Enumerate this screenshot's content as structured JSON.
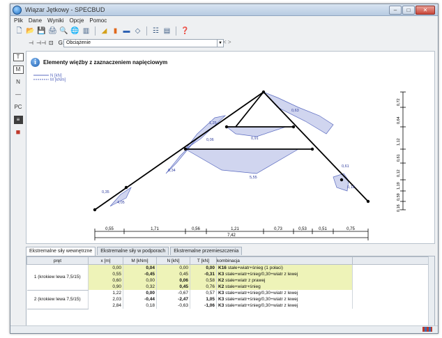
{
  "window": {
    "title": "Wiązar Jętkowy - SPECBUD",
    "controls": {
      "minimize": "–",
      "maximize": "□",
      "close": "✕"
    }
  },
  "menu": [
    "Plik",
    "Dane",
    "Wyniki",
    "Opcje",
    "Pomoc"
  ],
  "toolbar": {
    "icons": [
      "new-icon",
      "open-icon",
      "save-icon",
      "print-icon",
      "preview-icon",
      "globe-icon",
      "chart-icon",
      "triangle-icon",
      "bars-icon",
      "beam-icon",
      "diamond-icon",
      "grid-icon",
      "table-icon",
      "help-icon"
    ],
    "glyphs": [
      "🗋",
      "📂",
      "💾",
      "🖨",
      "🔍",
      "🌐",
      "▥",
      "◢",
      "▮",
      "▬",
      "◇",
      "☷",
      "▤",
      "❓"
    ]
  },
  "secondary_toolbar": {
    "buttons": [
      "⊣",
      "⊣⊣",
      "⊡"
    ],
    "load_case_label": "G:",
    "load_case_value": "Obciążenie",
    "nav": "< >"
  },
  "left_tools": [
    "T",
    "M",
    "N",
    "—",
    "PC",
    "≡",
    "■"
  ],
  "diagram": {
    "info_glyph": "i",
    "title": "Elementy więźby z zaznaczeniem napięciowym",
    "legend": [
      "N [kN]",
      "M [kNm]"
    ],
    "dimension_segments": [
      "0,55",
      "1,71",
      "0,56",
      "1,21",
      "0,73",
      "0,53",
      "0,51",
      "0,75"
    ],
    "dimension_total": "7,42",
    "vertical_dims": [
      "0,16",
      "0,59",
      "1,19",
      "0,12",
      "0,61",
      "1,12",
      "0,64",
      "0,72"
    ],
    "value_labels": [
      "0,35",
      "4,05",
      "0,34",
      "0,06",
      "0,91",
      "5,55",
      "0,63",
      "0,61",
      "0,12",
      "1,25"
    ],
    "colors": {
      "diagram_line": "#5b6bc0",
      "member": "#000000",
      "fill": "#8a96d6"
    }
  },
  "tabs": [
    "Ekstremalne siły wewnętrzne",
    "Ekstremalne siły w podporach",
    "Ekstremalne przemieszczenia"
  ],
  "table": {
    "headers": [
      "pręt",
      "x [m]",
      "M [kNm]",
      "N [kN]",
      "T [kN]",
      "kombinacja"
    ],
    "groups": [
      {
        "member": "1 (krokiew lewa 7,5/15)",
        "highlight": true,
        "rows": [
          {
            "x": "0,00",
            "M": "0,04",
            "N": "0,00",
            "T": "0,00",
            "code": "K16",
            "note": "stałe+wiatr+śnieg (1 połaci)"
          },
          {
            "x": "0,55",
            "M": "-0,45",
            "N": "0,45",
            "T": "-0,31",
            "code": "K3",
            "note": "stałe+wiatr+śnieg/0,30+wiatr z lewej"
          },
          {
            "x": "0,60",
            "M": "0,00",
            "N": "0,06",
            "T": "0,58",
            "code": "K2",
            "note": "stałe+wiatr z prawej"
          },
          {
            "x": "0,90",
            "M": "0,32",
            "N": "0,45",
            "T": "0,76",
            "code": "K2",
            "note": "stałe+wiatr+śnieg"
          }
        ]
      },
      {
        "member": "2 (krokiew lewa 7,5/15)",
        "highlight": false,
        "rows": [
          {
            "x": "1,22",
            "M": "0,00",
            "N": "-0,67",
            "T": "0,57",
            "code": "K3",
            "note": "stałe+wiatr+śnieg/0,30+wiatr z lewej"
          },
          {
            "x": "2,03",
            "M": "-0,44",
            "N": "-2,47",
            "T": "1,05",
            "code": "K3",
            "note": "stałe+wiatr+śnieg/0,30+wiatr z lewej"
          },
          {
            "x": "2,84",
            "M": "0,18",
            "N": "-0,63",
            "T": "-1,06",
            "code": "K3",
            "note": "stałe+wiatr+śnieg/0,30+wiatr z lewej"
          }
        ]
      }
    ]
  }
}
